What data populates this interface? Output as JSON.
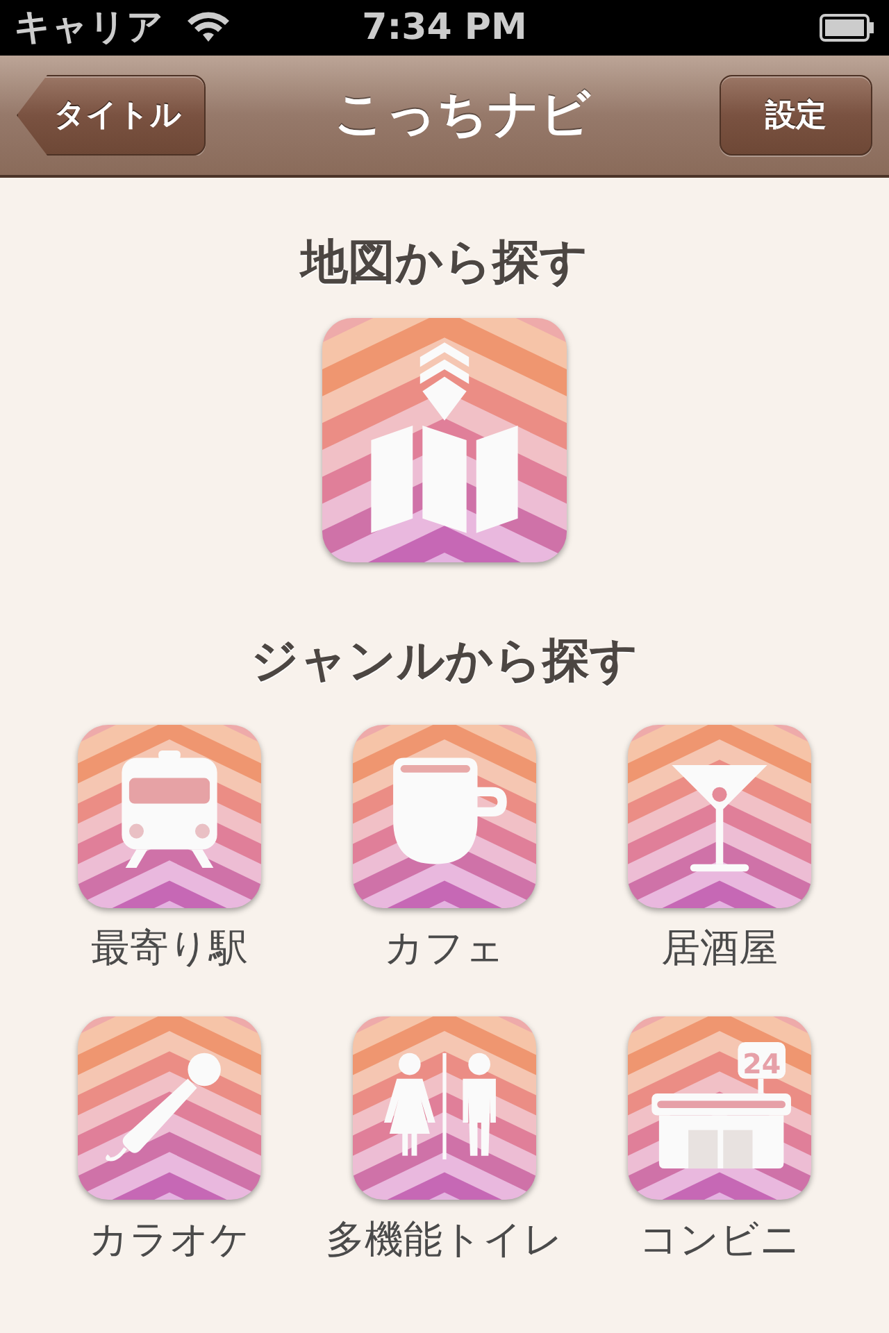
{
  "status_bar": {
    "carrier": "キャリア",
    "time": "7:34 PM"
  },
  "nav_bar": {
    "back_button": "タイトル",
    "title": "こっちナビ",
    "right_button": "設定"
  },
  "map_section": {
    "heading": "地図から探す",
    "tile": {
      "kind": "map"
    }
  },
  "genre_section": {
    "heading": "ジャンルから探す",
    "items": [
      {
        "kind": "train",
        "label": "最寄り駅"
      },
      {
        "kind": "cup",
        "label": "カフェ"
      },
      {
        "kind": "cocktail",
        "label": "居酒屋"
      },
      {
        "kind": "mic",
        "label": "カラオケ"
      },
      {
        "kind": "restroom",
        "label": "多機能トイレ"
      },
      {
        "kind": "store",
        "label": "コンビニ",
        "sign": "24"
      }
    ]
  }
}
